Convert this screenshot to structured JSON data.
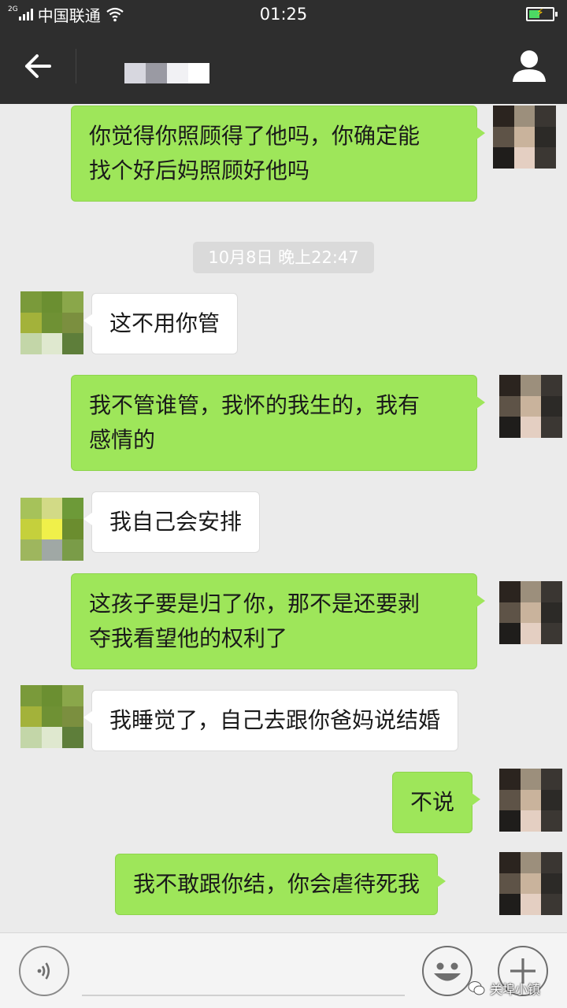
{
  "status_bar": {
    "network_type": "2G",
    "carrier": "中国联通",
    "time": "01:25",
    "battery_level": 0.45,
    "battery_charging": true
  },
  "nav": {
    "back_icon": "arrow-left-icon",
    "profile_icon": "person-icon",
    "title_pixel_colors": [
      "#d7d7df",
      "#9a9aa3",
      "#f1f1f4",
      "#ffffff"
    ]
  },
  "colors": {
    "sent_bubble": "#9ee65a",
    "recv_bubble": "#ffffff",
    "chat_background": "#ebebeb",
    "header_background": "#2e2e2e"
  },
  "chat": {
    "timestamp": "10月8日 晚上22:47",
    "messages": [
      {
        "side": "sent",
        "lines": [
          "你觉得你照顾得了他吗，你确定能",
          "找个好后妈照顾好他吗"
        ]
      },
      {
        "side": "received",
        "lines": [
          "这不用你管"
        ]
      },
      {
        "side": "sent",
        "lines": [
          "我不管谁管，我怀的我生的，我有",
          "感情的"
        ]
      },
      {
        "side": "received",
        "lines": [
          "我自己会安排"
        ]
      },
      {
        "side": "sent",
        "lines": [
          "这孩子要是归了你，那不是还要剥",
          "夺我看望他的权利了"
        ]
      },
      {
        "side": "received",
        "lines": [
          "我睡觉了，自己去跟你爸妈说结婚"
        ]
      },
      {
        "side": "sent",
        "lines": [
          "不说"
        ]
      },
      {
        "side": "sent",
        "lines": [
          "我不敢跟你结，你会虐待死我"
        ]
      }
    ],
    "avatars": {
      "self": [
        "#2b241f",
        "#9c8f7c",
        "#3a3632",
        "#5e5347",
        "#c9b39c",
        "#2c2a27",
        "#1f1d1b",
        "#e4cfc2",
        "#3b3733"
      ],
      "other": [
        "#7a9a3a",
        "#6b8f31",
        "#8aa74a",
        "#a3b23a",
        "#6f9134",
        "#7b8f3f",
        "#c3d6a8",
        "#dfe8cf",
        "#5e7e3a"
      ],
      "other_alt": [
        "#a6c25a",
        "#d2da86",
        "#6d9a38",
        "#c5d03c",
        "#f0f04a",
        "#6b8d2f",
        "#9eb65e",
        "#a0a8a5",
        "#7a9c48"
      ]
    }
  },
  "input_bar": {
    "voice_icon": "voice-icon",
    "emoji_icon": "emoji-icon",
    "plus_icon": "plus-icon",
    "input_value": "",
    "input_placeholder": ""
  },
  "watermark": {
    "text": "关埠小镇",
    "icon": "wechat-official-account-icon"
  }
}
